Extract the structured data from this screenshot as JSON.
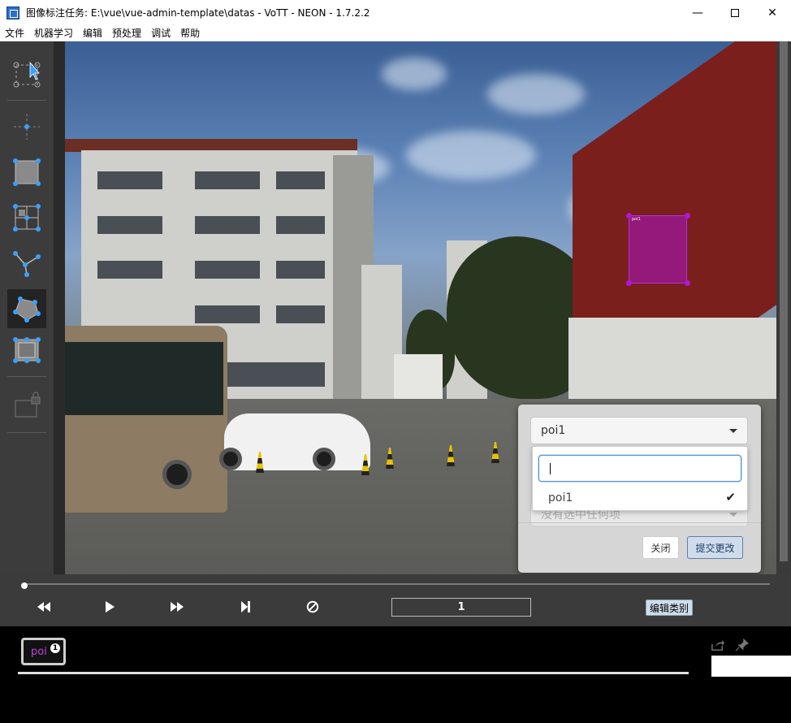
{
  "window": {
    "title": "图像标注任务: E:\\vue\\vue-admin-template\\datas - VoTT - NEON - 1.7.2.2",
    "controls": {
      "minimize": "—",
      "close": "✕"
    }
  },
  "menu": [
    "文件",
    "机器学习",
    "编辑",
    "预处理",
    "调试",
    "帮助"
  ],
  "toolbar": {
    "tools": [
      "select-tool",
      "point-tool",
      "rectangle-tool",
      "grid-rectangle-tool",
      "polyline-tool",
      "polygon-tool",
      "copy-rectangle-tool",
      "lock-tool"
    ],
    "active_tool": "polygon-tool"
  },
  "canvas": {
    "region_tag_text": "poi1",
    "region_color": "#b018d8"
  },
  "dialog": {
    "selected_label": "poi1",
    "search_value": "",
    "options": [
      {
        "label": "poi1",
        "checked": true
      }
    ],
    "second_select_placeholder": "没有选中任何项",
    "close_label": "关闭",
    "submit_label": "提交更改"
  },
  "playback": {
    "frame": "1",
    "edit_category_label": "编辑类别",
    "progress": 0.0
  },
  "tags": {
    "chip_label": "poi",
    "chip_badge": "1",
    "tag_color": "#c040e0"
  }
}
